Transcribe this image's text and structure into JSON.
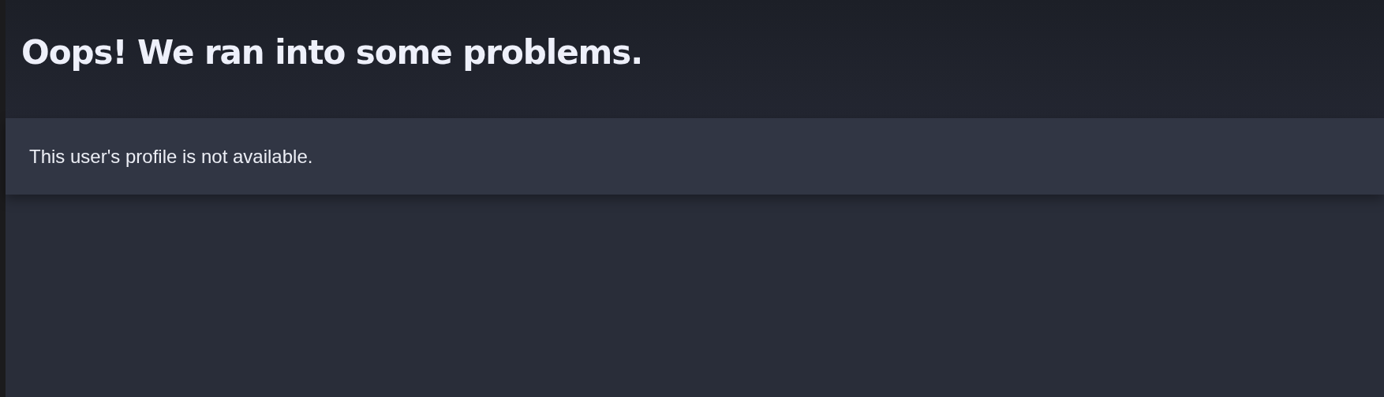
{
  "heading": "Oops! We ran into some problems.",
  "message": "This user's profile is not available."
}
